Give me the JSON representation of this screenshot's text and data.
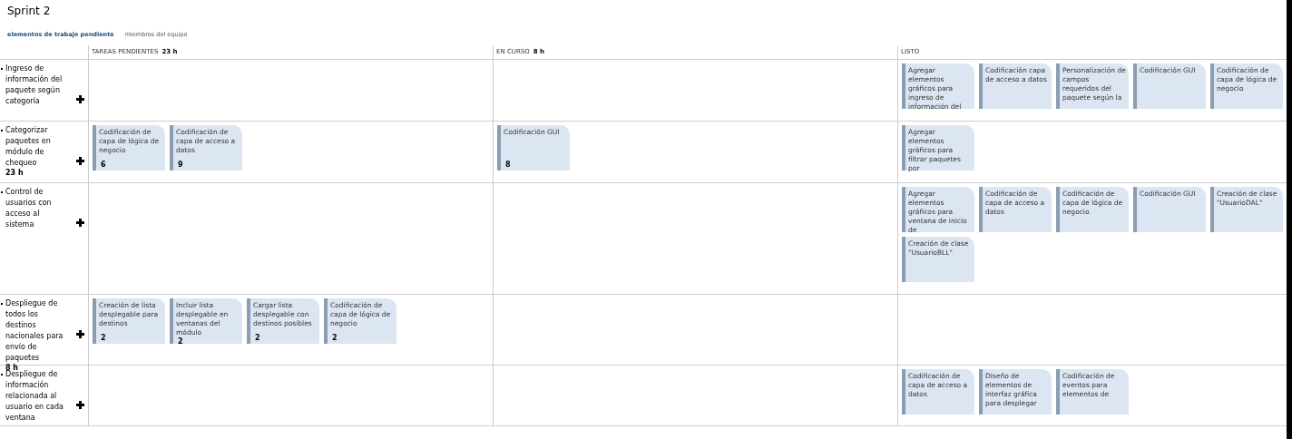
{
  "title": "Sprint 2",
  "tabs": [
    {
      "label": "elementos de trabajo pendiente",
      "selected": true
    },
    {
      "label": "miembros del equipo",
      "selected": false
    }
  ],
  "columns": [
    {
      "label": "TAREAS PENDIENTES",
      "hours": "23 h"
    },
    {
      "label": "EN CURSO",
      "hours": "8 h"
    },
    {
      "label": "LISTO"
    }
  ],
  "rows": [
    {
      "title": "Ingreso de información del paquete según categoría",
      "cells": [
        [],
        [],
        [
          {
            "text": "Agregar elementos gráficos para ingreso de información del"
          },
          {
            "text": "Codificación capa de acceso a datos"
          },
          {
            "text": "Personalización de campos requeridos del paquete según la"
          },
          {
            "text": "Codificación GUI"
          },
          {
            "text": "Codificación de capa de lógica de negocio"
          }
        ]
      ]
    },
    {
      "title": "Categorizar paquetes en módulo de chequeo",
      "hours": "23 h",
      "cells": [
        [
          {
            "text": "Codificación de capa de lógica de negocio",
            "hours": "6"
          },
          {
            "text": "Codificación de capa de acceso a datos",
            "hours": "9"
          }
        ],
        [
          {
            "text": "Codificación GUI",
            "hours": "8"
          }
        ],
        [
          {
            "text": "Agregar elementos gráficos para filtrar paquetes por"
          }
        ]
      ]
    },
    {
      "title": "Control de usuarios con acceso al sistema",
      "cells": [
        [],
        [],
        [
          {
            "text": "Agregar elementos gráficos para ventana de inicio de"
          },
          {
            "text": "Codificación de capa de acceso a datos"
          },
          {
            "text": "Codificación de capa de lógica de negocio"
          },
          {
            "text": "Codificación GUI"
          },
          {
            "text": "Creación de clase \"UsuarioDAL\""
          },
          {
            "text": "Creación de clase \"UsuarioBLL\""
          }
        ]
      ]
    },
    {
      "title": "Despliegue de todos los destinos nacionales para envío de paquetes",
      "hours": "8 h",
      "cells": [
        [
          {
            "text": "Creación de lista desplegable para destinos",
            "hours": "2"
          },
          {
            "text": "Incluir lista desplegable en ventanas del módulo",
            "hours": "2"
          },
          {
            "text": "Cargar lista desplegable con destinos posibles",
            "hours": "2"
          },
          {
            "text": "Codificación de capa de lógica de negocio",
            "hours": "2"
          }
        ],
        [],
        []
      ]
    },
    {
      "title": "Despliegue de información relacionada al usuario en cada ventana",
      "cells": [
        [],
        [],
        [
          {
            "text": "Codificación de capa de acceso a datos"
          },
          {
            "text": "Diseño de elementos de interfaz gráfica para desplegar"
          },
          {
            "text": "Codificación de eventos para elementos de"
          }
        ]
      ]
    }
  ]
}
